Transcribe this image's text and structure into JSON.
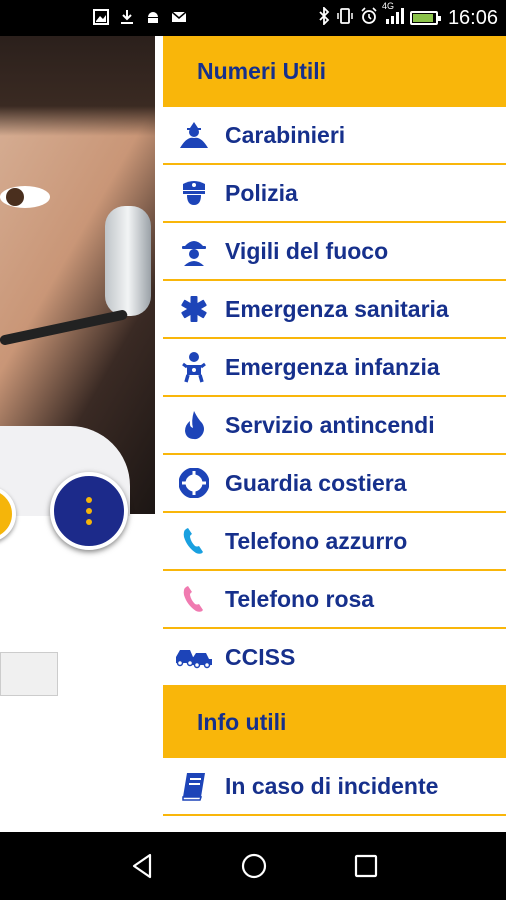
{
  "status_bar": {
    "time": "16:06",
    "network": "4G",
    "icons": [
      "gallery-icon",
      "download-icon",
      "android-icon",
      "mail-icon",
      "bluetooth-icon",
      "vibrate-icon",
      "alarm-icon",
      "signal-icon",
      "battery-icon"
    ],
    "battery_level": 0.85
  },
  "drawer": {
    "sections": [
      {
        "title": "Numeri Utili",
        "items": [
          {
            "label": "Carabinieri",
            "icon": "carabiniere-icon",
            "color": "#1d44b8"
          },
          {
            "label": "Polizia",
            "icon": "police-cap-icon",
            "color": "#1d44b8"
          },
          {
            "label": "Vigili del fuoco",
            "icon": "firefighter-icon",
            "color": "#1d44b8"
          },
          {
            "label": "Emergenza sanitaria",
            "icon": "medical-asterisk-icon",
            "color": "#1d44b8"
          },
          {
            "label": "Emergenza infanzia",
            "icon": "child-icon",
            "color": "#1d44b8"
          },
          {
            "label": "Servizio antincendi",
            "icon": "flame-icon",
            "color": "#1d44b8"
          },
          {
            "label": "Guardia costiera",
            "icon": "lifebuoy-icon",
            "color": "#1d44b8"
          },
          {
            "label": "Telefono azzurro",
            "icon": "phone-icon",
            "color": "#19a0e0"
          },
          {
            "label": "Telefono rosa",
            "icon": "phone-icon",
            "color": "#f07ab0"
          },
          {
            "label": "CCISS",
            "icon": "cars-icon",
            "color": "#1d44b8"
          }
        ]
      },
      {
        "title": "Info utili",
        "items": [
          {
            "label": "In caso di incidente",
            "icon": "book-icon",
            "color": "#1d44b8"
          }
        ]
      }
    ]
  },
  "nav_bar": {
    "buttons": [
      "back-icon",
      "home-icon",
      "recents-icon"
    ]
  }
}
